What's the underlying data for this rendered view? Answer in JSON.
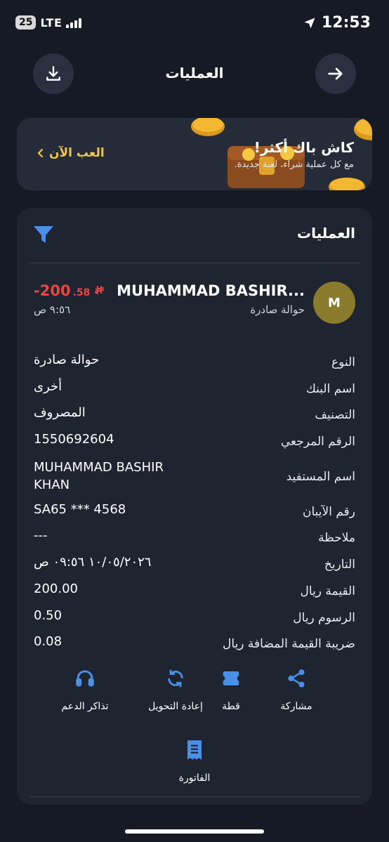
{
  "status_bar": {
    "battery": "25",
    "network": "LTE",
    "time": "12:53"
  },
  "header": {
    "title": "العمليات",
    "download_icon": "download-icon",
    "back_icon": "arrow-right-icon"
  },
  "promo": {
    "title": "كاش باك أكثر!",
    "subtitle": "مع كل عملية شراء، لعبة جديدة.",
    "cta": "العب الآن"
  },
  "transactions": {
    "title": "العمليات",
    "filter_icon": "filter-icon"
  },
  "transaction": {
    "avatar_initial": "M",
    "payee": "MUHAMMAD BASHIR...",
    "type_label": "حوالة صادرة",
    "amount_int": "-200",
    "amount_dec": ".58",
    "currency_symbol": "⃁",
    "time": "٩:٥٦ ص",
    "amount_color": "#e84545"
  },
  "details": [
    {
      "key": "النوع",
      "value": "حوالة صادرة"
    },
    {
      "key": "اسم البنك",
      "value": "أخرى"
    },
    {
      "key": "التصنيف",
      "value": "المصروف"
    },
    {
      "key": "الرقم المرجعي",
      "value": "1550692604"
    },
    {
      "key": "اسم المستفيد",
      "value": "MUHAMMAD BASHIR KHAN"
    },
    {
      "key": "رقم الآيبان",
      "value": "SA65 *** 4568"
    },
    {
      "key": "ملاحظة",
      "value": "---"
    },
    {
      "key": "التاريخ",
      "value": "١٠/٠٥/٢٠٢٦ ٠٩:٥٦ ص"
    },
    {
      "key": "القيمة ريال",
      "value": "200.00"
    },
    {
      "key": "الرسوم ريال",
      "value": "0.50"
    },
    {
      "key": "ضريبة القيمة المضافة ريال",
      "value": "0.08"
    }
  ],
  "actions": [
    {
      "label": "مشاركة",
      "icon": "share-icon"
    },
    {
      "label": "قطة",
      "icon": "split-bill-icon"
    },
    {
      "label": "إعادة التحويل",
      "icon": "repeat-icon"
    },
    {
      "label": "تذاكر الدعم",
      "icon": "headset-icon"
    }
  ],
  "invoice": {
    "label": "الفاتورة",
    "icon": "receipt-icon"
  },
  "colors": {
    "background": "#151a24",
    "card": "#1e2430",
    "accent_blue": "#4a90e8",
    "gold": "#f4c842",
    "negative": "#e84545"
  }
}
